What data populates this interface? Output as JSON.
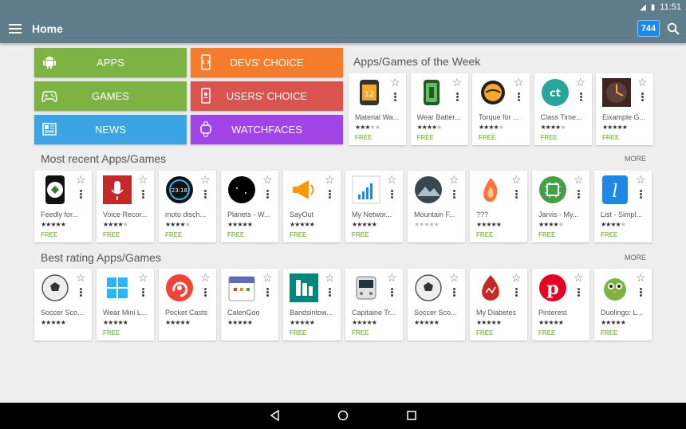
{
  "statusbar": {
    "time": "11:51"
  },
  "appbar": {
    "title": "Home",
    "badge": "744"
  },
  "categories": [
    {
      "label": "APPS",
      "color": "#7cb342",
      "icon": "android-icon"
    },
    {
      "label": "DEVS' CHOICE",
      "color": "#f57c2b",
      "icon": "phone-icon"
    },
    {
      "label": "GAMES",
      "color": "#7cb342",
      "icon": "gamepad-icon"
    },
    {
      "label": "USERS' CHOICE",
      "color": "#d9534f",
      "icon": "user-phone-icon"
    },
    {
      "label": "NEWS",
      "color": "#3aa3e3",
      "icon": "newspaper-icon"
    },
    {
      "label": "WATCHFACES",
      "color": "#a044e8",
      "icon": "watch-icon"
    }
  ],
  "week": {
    "title": "Apps/Games of the Week",
    "items": [
      {
        "name": "Material Wa...",
        "stars": 3,
        "free": "FREE",
        "icon": "material-watch-icon"
      },
      {
        "name": "Wear Batter...",
        "stars": 4,
        "free": "FREE",
        "icon": "wear-battery-icon"
      },
      {
        "name": "Torque for ...",
        "stars": 4,
        "free": "FREE",
        "icon": "torque-icon"
      },
      {
        "name": "Class Time...",
        "stars": 4,
        "free": "FREE",
        "icon": "class-time-icon"
      },
      {
        "name": "Eixample G...",
        "stars": 5,
        "free": "FREE",
        "icon": "eixample-icon"
      }
    ]
  },
  "recent": {
    "title": "Most recent Apps/Games",
    "more": "MORE",
    "items": [
      {
        "name": "Feedly for...",
        "stars": 5,
        "free": "FREE",
        "icon": "feedly-icon"
      },
      {
        "name": "Voice Recor...",
        "stars": 4,
        "free": "FREE",
        "icon": "microphone-icon"
      },
      {
        "name": "moto disch...",
        "stars": 4,
        "free": "FREE",
        "icon": "moto-watch-icon"
      },
      {
        "name": "Planets - W...",
        "stars": 5,
        "free": "FREE",
        "icon": "planets-icon"
      },
      {
        "name": "SayOut",
        "stars": 5,
        "free": "FREE",
        "icon": "megaphone-icon"
      },
      {
        "name": "My Networ...",
        "stars": 5,
        "free": "FREE",
        "icon": "network-icon"
      },
      {
        "name": "Mountain F...",
        "stars": 0,
        "free": "",
        "icon": "mountain-icon"
      },
      {
        "name": "???",
        "stars": 5,
        "free": "FREE",
        "icon": "fire-hand-icon"
      },
      {
        "name": "Jarvis - My...",
        "stars": 4,
        "free": "FREE",
        "icon": "jarvis-icon"
      },
      {
        "name": "List - Simpl...",
        "stars": 4,
        "free": "FREE",
        "icon": "list-icon"
      }
    ]
  },
  "best": {
    "title": "Best rating Apps/Games",
    "more": "MORE",
    "items": [
      {
        "name": "Soccer Sco...",
        "stars": 5,
        "free": "",
        "icon": "soccer-ball-icon"
      },
      {
        "name": "Wear Mini L...",
        "stars": 5,
        "free": "FREE",
        "icon": "wear-mini-icon"
      },
      {
        "name": "Pocket Casts",
        "stars": 5,
        "free": "",
        "icon": "pocket-casts-icon"
      },
      {
        "name": "CalenGoo",
        "stars": 5,
        "free": "",
        "icon": "calendar-icon"
      },
      {
        "name": "Bandsintow...",
        "stars": 5,
        "free": "FREE",
        "icon": "bandsintown-icon"
      },
      {
        "name": "Capitaine Tr...",
        "stars": 5,
        "free": "FREE",
        "icon": "train-icon"
      },
      {
        "name": "Soccer Sco...",
        "stars": 5,
        "free": "",
        "icon": "soccer-ball-icon"
      },
      {
        "name": "My Diabetes",
        "stars": 5,
        "free": "FREE",
        "icon": "diabetes-icon"
      },
      {
        "name": "Pinterest",
        "stars": 5,
        "free": "FREE",
        "icon": "pinterest-icon"
      },
      {
        "name": "Duolingo: L...",
        "stars": 5,
        "free": "FREE",
        "icon": "duolingo-icon"
      }
    ]
  }
}
